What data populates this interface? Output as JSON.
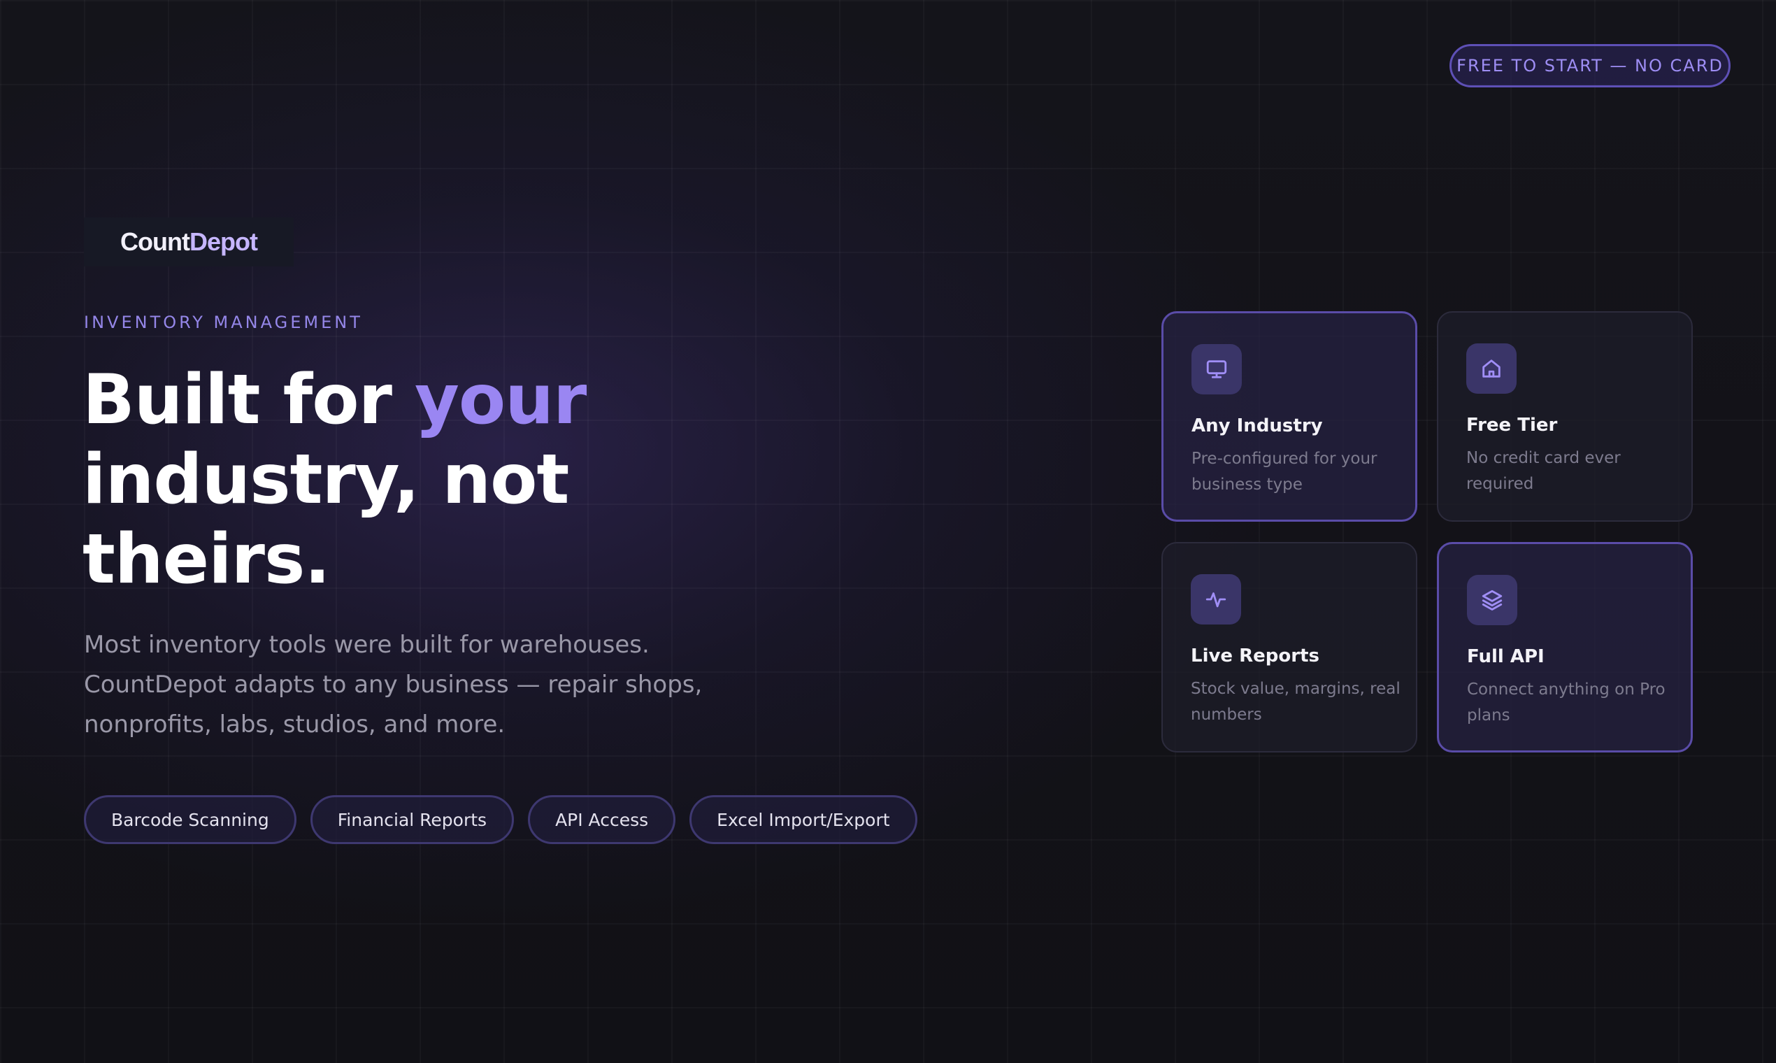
{
  "badge": {
    "label": "FREE TO START — NO CARD"
  },
  "logo": {
    "part1": "Count",
    "part2": "Depot"
  },
  "hero": {
    "eyebrow": "INVENTORY MANAGEMENT",
    "headline_line1_a": "Built for ",
    "headline_line1_accent": "your",
    "headline_line2": "industry, not",
    "headline_line3": "theirs.",
    "lede_line1": "Most inventory tools were built for warehouses.",
    "lede_line2": "CountDepot adapts to any business — repair shops,",
    "lede_line3": "nonprofits, labs, studios, and more."
  },
  "chips": [
    {
      "label": "Barcode Scanning"
    },
    {
      "label": "Financial Reports"
    },
    {
      "label": "API Access"
    },
    {
      "label": "Excel Import/Export"
    }
  ],
  "features": [
    {
      "title": "Any Industry",
      "desc": "Pre-configured for your business type",
      "icon": "monitor-icon"
    },
    {
      "title": "Free Tier",
      "desc": "No credit card ever required",
      "icon": "home-icon"
    },
    {
      "title": "Live Reports",
      "desc": "Stock value, margins, real numbers",
      "icon": "activity-icon"
    },
    {
      "title": "Full API",
      "desc": "Connect anything on Pro plans",
      "icon": "layers-icon"
    }
  ],
  "colors": {
    "accent": "#9a86f2",
    "background": "#131218",
    "card_border_highlight": "#5a4ca8"
  }
}
